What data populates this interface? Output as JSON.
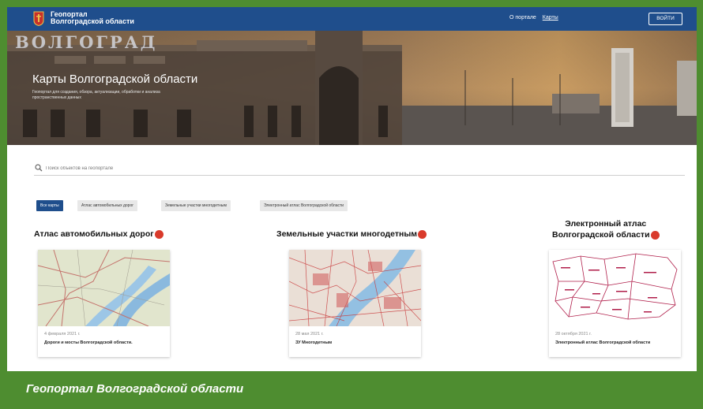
{
  "header": {
    "brand_line1": "Геопортал",
    "brand_line2": "Волгоградской области",
    "nav_about": "О портале",
    "nav_maps": "Карты",
    "login_label": "ВОЙТИ"
  },
  "hero": {
    "title": "Карты Волгоградской области",
    "subtitle": "Геопортал для создания, обзора, актуализации, обработки и анализа пространственных данных",
    "sign_text": "ВОЛГОГРАД"
  },
  "search": {
    "placeholder": "Поиск объектов на геопортале"
  },
  "filters": [
    "Все карты",
    "Атлас автомобильных дорог",
    "Земельные участки многодетным",
    "Электронный атлас Волгоградской области"
  ],
  "sections": [
    {
      "title": "Атлас автомобильных дорог",
      "date": "4 февраля 2021 г.",
      "name": "Дороги и мосты Волгоградской области."
    },
    {
      "title": "Земельные участки многодетным",
      "date": "28 мая 2021 г.",
      "name": "ЗУ Многодетным"
    },
    {
      "title_line1": "Электронный атлас",
      "title_line2": "Волгоградской области",
      "date": "28 октября 2021 г.",
      "name": "Электронный атлас Волгоградской области"
    }
  ],
  "caption": "Геопортал Волгоградской области",
  "colors": {
    "topbar": "#1f4e8c",
    "frame": "#4e8d30",
    "badge": "#d93a2b"
  }
}
